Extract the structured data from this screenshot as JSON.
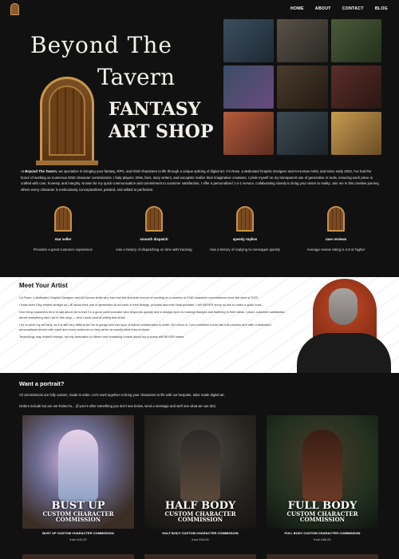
{
  "nav": {
    "items": [
      "HOME",
      "ABOUT",
      "CONTACT",
      "BLOG"
    ]
  },
  "hero": {
    "brand_line1": "Beyond The",
    "brand_line2": "Tavern",
    "brand_line3": "FANTASY",
    "brand_line4": "ART SHOP",
    "gallery_count": 9
  },
  "intro": {
    "lead": "At ",
    "brand": "Beyond The Tavern",
    "text": ", we specialize in bringing your fantasy, RPG, and DND characters to life through a unique splicing of digital art. I'm Rose, a dedicated Graphic Designer and AI-Human Artist, and since early 2023, I've had the honor of working on numerous DND character commissions. I help players, DMs, fans, story writers, and escapists realize their imaginative creations. I pride myself on my transparent use of generative AI tools, ensuring each piece is crafted with care, honesty, and integrity. Known for my quick communication and commitment to customer satisfaction, I offer a personalized 1-2-1 service, collaborating closely to bring your vision to reality. Join me in this creative journey, where every character is meticulously conceptualized, painted, and edited to perfection."
  },
  "features": [
    {
      "title": "star seller",
      "desc": "Provides a great customer experience"
    },
    {
      "title": "smooth dispatch",
      "desc": "Has a history of dispatching on time with tracking"
    },
    {
      "title": "speedy replies",
      "desc": "Has a history of replying to messages quickly"
    },
    {
      "title": "rave reviews",
      "desc": "Average review rating is 4.8 or higher"
    }
  ],
  "artist": {
    "heading": "Meet Your Artist",
    "paragraphs": [
      "I'm Rose, a dedicated Graphic Designer and AI-Human Artist who has had the absolute honour of working on a number of DND character commissions since the start of 2023.",
      "I have seen Etsy sellers straight up LIE about their use of generative AI art tools in their listings, process and even final portraits. I will NEVER stoop so low to make a quick buck.",
      "One thing customers tend to say about me is that I'm a good communicator who responds quickly and is always open to making changes and listening to their ideas. I place customer satisfaction above everything else I do in this shop — and I work hard at letting that show.",
      "I try to price my art fairly, as it is still very difficult for me to gauge how this type of hybrid collaboration is worth. All I know is, I put countless hours into this process and offer a dedicated personalised service with each and every customer so they arrive at exactly what they envision.",
      "Technology may indeed change, but my dedication to others and remaining honest about my process will NEVER waver."
    ]
  },
  "portrait": {
    "heading": "Want a portrait?",
    "p1": "All commissions are fully custom, made to order. Let's work together to bring your characters to life with our bespoke, tailor made digital art.",
    "p2": "Orders include but are not limited to... (if you're after something you don't see below, send a message and we'll see what we can do!)"
  },
  "cards": [
    {
      "big": "BUST UP",
      "sub1": "CUSTOM CHARACTER",
      "sub2": "COMMISSION",
      "caption": "BUST UP CUSTOM CHARACTER COMMISSION",
      "price": "from £42.00"
    },
    {
      "big": "HALF BODY",
      "sub1": "CUSTOM CHARACTER",
      "sub2": "COMMISSION",
      "caption": "HALF BODY CUSTOM CHARACTER COMMISSION",
      "price": "from £54.00"
    },
    {
      "big": "FULL BODY",
      "sub1": "CUSTOM CHARACTER",
      "sub2": "COMMISSION",
      "caption": "FULL BODY CUSTOM CHARACTER COMMISSION",
      "price": "from £66.00"
    }
  ]
}
